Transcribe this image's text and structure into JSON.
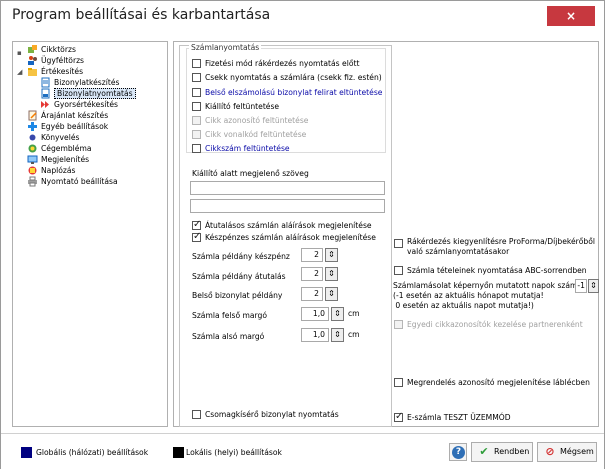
{
  "window": {
    "title": "Program beállításai és karbantartása",
    "close_label": "×"
  },
  "tree": [
    {
      "label": "Cikktörzs",
      "icon": "puzzle-icon"
    },
    {
      "label": "Ügyféltörzs",
      "icon": "people-icon"
    },
    {
      "label": "Értékesítés",
      "icon": "folder-open-icon"
    },
    {
      "label": "Bizonylatkészítés",
      "icon": "document-icon"
    },
    {
      "label": "Bizonylatnyomtatás",
      "icon": "print-document-icon"
    },
    {
      "label": "Gyorsértékesítés",
      "icon": "fast-forward-icon"
    },
    {
      "label": "Árajánlat készítés",
      "icon": "document-edit-icon"
    },
    {
      "label": "Egyéb beállítások",
      "icon": "tools-icon"
    },
    {
      "label": "Könyvelés",
      "icon": "ledger-icon"
    },
    {
      "label": "Cégembléma",
      "icon": "logo-icon"
    },
    {
      "label": "Megjelenítés",
      "icon": "display-icon"
    },
    {
      "label": "Naplózás",
      "icon": "log-icon"
    },
    {
      "label": "Nyomtató beállítása",
      "icon": "printer-icon"
    }
  ],
  "invoice_print": {
    "group_title": "Számlanyomtatás",
    "items": [
      {
        "label": "Fizetési mód rákérdezés nyomtatás előtt",
        "checked": false,
        "style": "normal"
      },
      {
        "label": "Csekk nyomtatás a számlára (csekk fiz. estén)",
        "checked": false,
        "style": "normal"
      },
      {
        "label": "Belső elszámolású bizonylat felirat eltüntetése",
        "checked": false,
        "style": "blue"
      },
      {
        "label": "Kiállító feltüntetése",
        "checked": false,
        "style": "normal"
      },
      {
        "label": "Cikk azonosító feltüntetése",
        "checked": false,
        "style": "disabled"
      },
      {
        "label": "Cikk vonalkód feltüntetése",
        "checked": false,
        "style": "disabled"
      },
      {
        "label": "Cikkszám feltüntetése",
        "checked": false,
        "style": "blue"
      }
    ]
  },
  "issuer_text": {
    "label": "Kiállító alatt megjelenő szöveg",
    "line1": "",
    "line2": ""
  },
  "signature": {
    "transfer_label": "Átutalásos számlán aláírások megjelenítése",
    "transfer_checked": true,
    "cash_label": "Készpénzes számlán aláírások megjelenítése",
    "cash_checked": true
  },
  "copies": {
    "cash_label": "Számla példány készpénz",
    "cash_value": "2",
    "transfer_label": "Számla példány átutalás",
    "transfer_value": "2",
    "internal_label": "Belső bizonylat példány",
    "internal_value": "2"
  },
  "margins": {
    "top_label": "Számla felső margó",
    "top_value": "1,0",
    "top_unit": "cm",
    "bottom_label": "Számla alsó margó",
    "bottom_value": "1,0",
    "bottom_unit": "cm"
  },
  "package_label": "Csomagkísérő bizonylat nyomtatás",
  "right": {
    "proforma_label": "Rákérdezés kiegyenlítésre ProForma/Díjbekérőből való számlanyomtatásakor",
    "abc_label": "Számla tételeinek nyomtatása ABC-sorrendben",
    "days_label_1": "Számlamásolat képernyőn mutatott napok száma:",
    "days_label_2": "(-1 esetén az aktuális hónapot mutatja!",
    "days_label_3": " 0 esetén az aktuális napot mutatja!)",
    "days_value": "-1",
    "partner_label": "Egyedi cikkazonosítók kezelése partnerenként",
    "order_id_label": "Megrendelés azonosító megjelenítése láblécben",
    "test_mode_label": "E-számla TESZT ÜZEMMÓD",
    "test_mode_checked": true
  },
  "footer": {
    "global_label": "Globális (hálózati) beállítások",
    "global_color": "#000080",
    "local_label": "Lokális (helyi) beállítások",
    "local_color": "#000000",
    "ok_label": "Rendben",
    "cancel_label": "Mégsem"
  }
}
